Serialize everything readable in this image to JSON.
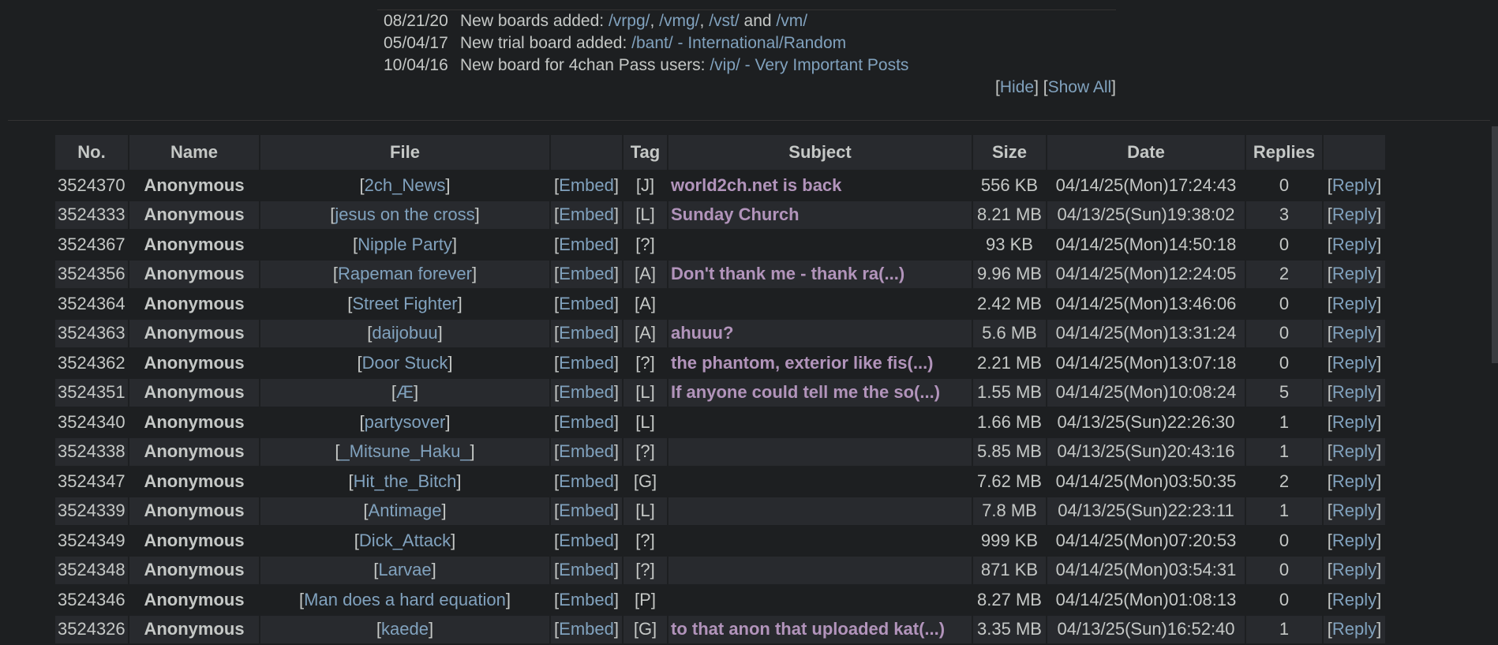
{
  "news": [
    {
      "date": "08/21/20",
      "parts": [
        {
          "t": "New boards added: ",
          "link": false
        },
        {
          "t": "/vrpg/",
          "link": true
        },
        {
          "t": ", ",
          "link": false
        },
        {
          "t": "/vmg/",
          "link": true
        },
        {
          "t": ", ",
          "link": false
        },
        {
          "t": "/vst/",
          "link": true
        },
        {
          "t": " and ",
          "link": false
        },
        {
          "t": "/vm/",
          "link": true
        }
      ]
    },
    {
      "date": "05/04/17",
      "parts": [
        {
          "t": "New trial board added: ",
          "link": false
        },
        {
          "t": "/bant/ - International/Random",
          "link": true
        }
      ]
    },
    {
      "date": "10/04/16",
      "parts": [
        {
          "t": "New board for 4chan Pass users: ",
          "link": false
        },
        {
          "t": "/vip/ - Very Important Posts",
          "link": true
        }
      ]
    }
  ],
  "news_controls": {
    "hide": "Hide",
    "show_all": "Show All"
  },
  "table": {
    "headers": [
      "No.",
      "Name",
      "File",
      "",
      "Tag",
      "Subject",
      "Size",
      "Date",
      "Replies",
      ""
    ],
    "rows": [
      {
        "no": "3524370",
        "name": "Anonymous",
        "file": "2ch_News",
        "embed": "Embed",
        "tag": "[J]",
        "subject": "world2ch.net is back",
        "size": "556 KB",
        "date": "04/14/25(Mon)17:24:43",
        "replies": "0",
        "reply": "Reply"
      },
      {
        "no": "3524333",
        "name": "Anonymous",
        "file": "jesus on the cross",
        "embed": "Embed",
        "tag": "[L]",
        "subject": "Sunday Church",
        "size": "8.21 MB",
        "date": "04/13/25(Sun)19:38:02",
        "replies": "3",
        "reply": "Reply"
      },
      {
        "no": "3524367",
        "name": "Anonymous",
        "file": "Nipple Party",
        "embed": "Embed",
        "tag": "[?]",
        "subject": "",
        "size": "93 KB",
        "date": "04/14/25(Mon)14:50:18",
        "replies": "0",
        "reply": "Reply"
      },
      {
        "no": "3524356",
        "name": "Anonymous",
        "file": "Rapeman forever",
        "embed": "Embed",
        "tag": "[A]",
        "subject": "Don't thank me - thank ra(...)",
        "size": "9.96 MB",
        "date": "04/14/25(Mon)12:24:05",
        "replies": "2",
        "reply": "Reply"
      },
      {
        "no": "3524364",
        "name": "Anonymous",
        "file": "Street Fighter",
        "embed": "Embed",
        "tag": "[A]",
        "subject": "",
        "size": "2.42 MB",
        "date": "04/14/25(Mon)13:46:06",
        "replies": "0",
        "reply": "Reply"
      },
      {
        "no": "3524363",
        "name": "Anonymous",
        "file": "daijobuu",
        "embed": "Embed",
        "tag": "[A]",
        "subject": "ahuuu?",
        "size": "5.6 MB",
        "date": "04/14/25(Mon)13:31:24",
        "replies": "0",
        "reply": "Reply"
      },
      {
        "no": "3524362",
        "name": "Anonymous",
        "file": "Door Stuck",
        "embed": "Embed",
        "tag": "[?]",
        "subject": "the phantom, exterior like fis(...)",
        "size": "2.21 MB",
        "date": "04/14/25(Mon)13:07:18",
        "replies": "0",
        "reply": "Reply"
      },
      {
        "no": "3524351",
        "name": "Anonymous",
        "file": "Æ",
        "embed": "Embed",
        "tag": "[L]",
        "subject": "If anyone could tell me the so(...)",
        "size": "1.55 MB",
        "date": "04/14/25(Mon)10:08:24",
        "replies": "5",
        "reply": "Reply"
      },
      {
        "no": "3524340",
        "name": "Anonymous",
        "file": "partysover",
        "embed": "Embed",
        "tag": "[L]",
        "subject": "",
        "size": "1.66 MB",
        "date": "04/13/25(Sun)22:26:30",
        "replies": "1",
        "reply": "Reply"
      },
      {
        "no": "3524338",
        "name": "Anonymous",
        "file": "_Mitsune_Haku_",
        "embed": "Embed",
        "tag": "[?]",
        "subject": "",
        "size": "5.85 MB",
        "date": "04/13/25(Sun)20:43:16",
        "replies": "1",
        "reply": "Reply"
      },
      {
        "no": "3524347",
        "name": "Anonymous",
        "file": "Hit_the_Bitch",
        "embed": "Embed",
        "tag": "[G]",
        "subject": "",
        "size": "7.62 MB",
        "date": "04/14/25(Mon)03:50:35",
        "replies": "2",
        "reply": "Reply"
      },
      {
        "no": "3524339",
        "name": "Anonymous",
        "file": "Antimage",
        "embed": "Embed",
        "tag": "[L]",
        "subject": "",
        "size": "7.8 MB",
        "date": "04/13/25(Sun)22:23:11",
        "replies": "1",
        "reply": "Reply"
      },
      {
        "no": "3524349",
        "name": "Anonymous",
        "file": "Dick_Attack",
        "embed": "Embed",
        "tag": "[?]",
        "subject": "",
        "size": "999 KB",
        "date": "04/14/25(Mon)07:20:53",
        "replies": "0",
        "reply": "Reply"
      },
      {
        "no": "3524348",
        "name": "Anonymous",
        "file": "Larvae",
        "embed": "Embed",
        "tag": "[?]",
        "subject": "",
        "size": "871 KB",
        "date": "04/14/25(Mon)03:54:31",
        "replies": "0",
        "reply": "Reply"
      },
      {
        "no": "3524346",
        "name": "Anonymous",
        "file": "Man does a hard equation",
        "embed": "Embed",
        "tag": "[P]",
        "subject": "",
        "size": "8.27 MB",
        "date": "04/14/25(Mon)01:08:13",
        "replies": "0",
        "reply": "Reply"
      },
      {
        "no": "3524326",
        "name": "Anonymous",
        "file": "kaede",
        "embed": "Embed",
        "tag": "[G]",
        "subject": "to that anon that uploaded kat(...)",
        "size": "3.35 MB",
        "date": "04/13/25(Sun)16:52:40",
        "replies": "1",
        "reply": "Reply"
      }
    ]
  }
}
